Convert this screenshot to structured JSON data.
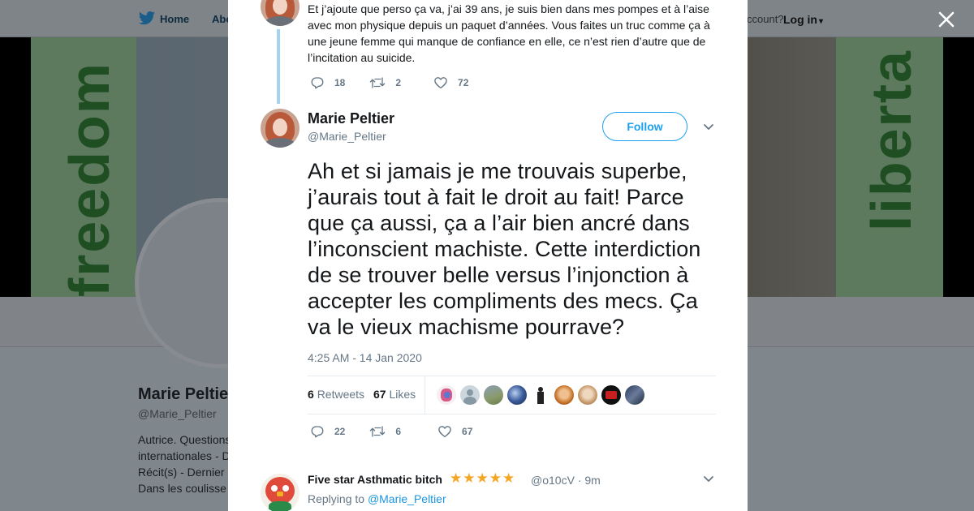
{
  "background": {
    "nav": {
      "home_label": "Home",
      "about_label": "Abo",
      "account_text": "ccount?",
      "login_label": "Log in"
    },
    "banner": {
      "left_text": "freedom",
      "right_text": "liberta"
    },
    "profile": {
      "name": "Marie Peltie",
      "handle": "@Marie_Peltier",
      "bio_lines": [
        "Autrice. Questions",
        "internationales - D",
        "Récit(s) - Dernier",
        "Dans les coulisse"
      ]
    }
  },
  "close_icon": "close-icon",
  "parent_tweet": {
    "text": "Et j’ajoute que perso ça va, j’ai 39 ans, je suis bien dans mes pompes et à l’aise avec mon physique depuis un paquet d’années. Vous faites un truc comme ça à une jeune femme qui manque de confiance en elle, ce n’est rien d’autre que de l’incitation au suicide.",
    "replies": "18",
    "retweets": "2",
    "likes": "72"
  },
  "main_tweet": {
    "author_name": "Marie Peltier",
    "author_handle": "@Marie_Peltier",
    "follow_label": "Follow",
    "text": "Ah et si jamais je me trouvais superbe, j’aurais tout à fait le droit au fait! Parce que ça aussi, ça a l’air bien ancré dans l’inconscient machiste. Cette interdiction de se trouver belle versus l’injonction à accepter les compliments des mecs. Ça va le vieux machisme pourrave?",
    "timestamp": "4:25 AM - 14 Jan 2020",
    "retweets_count": "6",
    "retweets_label": "Retweets",
    "likes_count": "67",
    "likes_label": "Likes",
    "replies": "22",
    "retweets": "6",
    "likes": "67"
  },
  "reply_tweet": {
    "author_name": "Five star Asthmatic bitch",
    "stars": "★★★★★",
    "author_handle": "@o10cV",
    "time": "· 9m",
    "replying_to_label": "Replying to",
    "replying_to_handle": "@Marie_Peltier"
  },
  "colors": {
    "accent": "#1da1f2",
    "thread_line": "#a6d3f2",
    "muted": "#657786",
    "stars": "#f5a623"
  }
}
